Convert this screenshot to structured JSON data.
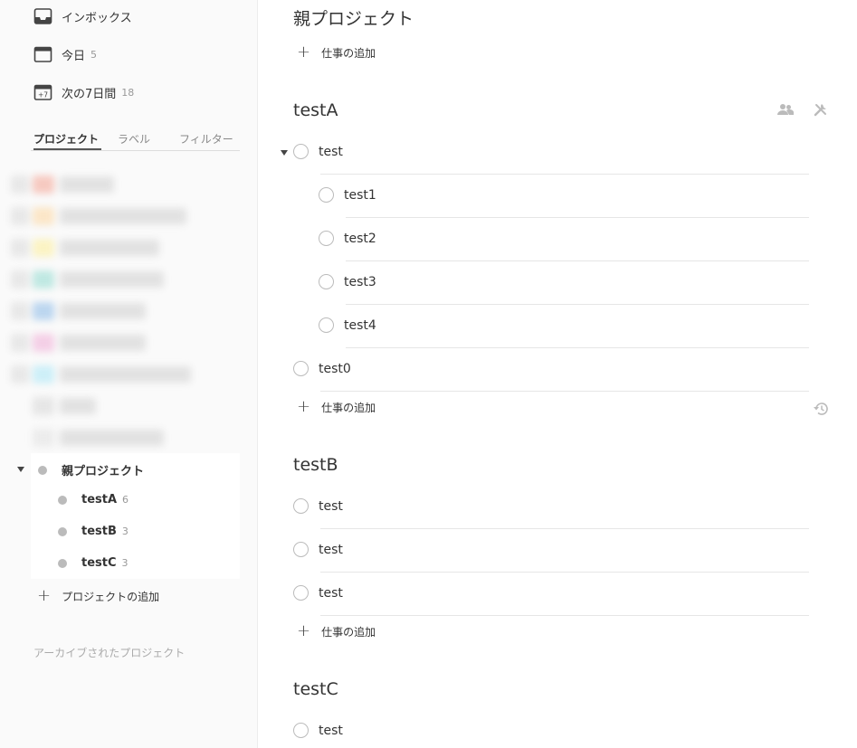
{
  "sidebar": {
    "nav": [
      {
        "label": "インボックス",
        "count": "",
        "icon": "inbox-icon"
      },
      {
        "label": "今日",
        "count": "5",
        "icon": "calendar-today-icon"
      },
      {
        "label": "次の7日間",
        "count": "18",
        "icon": "calendar-week-icon"
      }
    ],
    "week_icon_text": "+7",
    "tabs": [
      "プロジェクト",
      "ラベル",
      "フィルター"
    ],
    "projects": [
      {
        "label": "親プロジェクト",
        "count": ""
      },
      {
        "label": "testA",
        "count": "6"
      },
      {
        "label": "testB",
        "count": "3"
      },
      {
        "label": "testC",
        "count": "3"
      }
    ],
    "add_project": "プロジェクトの追加",
    "archived": "アーカイブされたプロジェクト"
  },
  "main": {
    "add_task_label": "仕事の追加",
    "parent": {
      "title": "親プロジェクト"
    },
    "testA": {
      "title": "testA",
      "tasks": [
        "test",
        "test1",
        "test2",
        "test3",
        "test4",
        "test0"
      ]
    },
    "testB": {
      "title": "testB",
      "tasks": [
        "test",
        "test",
        "test"
      ]
    },
    "testC": {
      "title": "testC",
      "tasks": [
        "test"
      ]
    }
  }
}
